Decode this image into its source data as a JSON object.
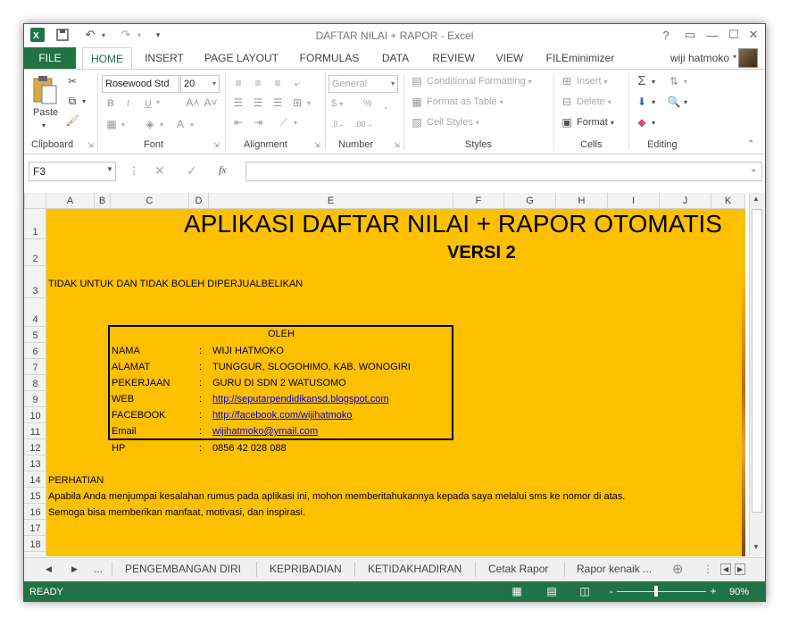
{
  "app": {
    "title": "DAFTAR NILAI + RAPOR - Excel",
    "user": "wiji hatmoko",
    "colors": {
      "excel_green": "#217346",
      "sheet_fill": "#ffc000",
      "link": "#0000ee"
    }
  },
  "quick_access": {
    "icons": [
      "excel-logo-icon",
      "save-icon",
      "undo-icon",
      "redo-icon",
      "customize-icon"
    ]
  },
  "window_controls": {
    "help": "?",
    "restore": "▭",
    "minimize": "—",
    "maximize": "☐",
    "close": "✕"
  },
  "ribbon_tabs": [
    "FILE",
    "HOME",
    "INSERT",
    "PAGE LAYOUT",
    "FORMULAS",
    "DATA",
    "REVIEW",
    "VIEW",
    "FILEminimizer"
  ],
  "ribbon": {
    "clipboard": {
      "label": "Clipboard",
      "paste": "Paste"
    },
    "font": {
      "label": "Font",
      "font_name": "Rosewood Std",
      "font_size": "20",
      "bold": "B",
      "italic": "I",
      "underline": "U"
    },
    "alignment": {
      "label": "Alignment"
    },
    "number": {
      "label": "Number",
      "format": "General",
      "currency": "$",
      "percent": "%",
      "comma": ","
    },
    "styles": {
      "label": "Styles",
      "conditional": "Conditional Formatting",
      "format_table": "Format as Table",
      "cell_styles": "Cell Styles"
    },
    "cells": {
      "label": "Cells",
      "insert": "Insert",
      "delete": "Delete",
      "format": "Format"
    },
    "editing": {
      "label": "Editing"
    }
  },
  "formula_bar": {
    "name_box": "F3",
    "fx": "fx",
    "content": ""
  },
  "columns": [
    "A",
    "B",
    "C",
    "D",
    "E",
    "F",
    "G",
    "H",
    "I",
    "J",
    "K"
  ],
  "rows": [
    "1",
    "2",
    "3",
    "4",
    "5",
    "6",
    "7",
    "8",
    "9",
    "10",
    "11",
    "12",
    "13",
    "14",
    "15",
    "16",
    "17",
    "18"
  ],
  "sheet": {
    "title": "APLIKASI DAFTAR NILAI + RAPOR OTOMATIS",
    "version": "VERSI 2",
    "notice": "TIDAK UNTUK DAN TIDAK BOLEH DIPERJUALBELIKAN",
    "by": "OLEH",
    "info": [
      {
        "label": "NAMA",
        "sep": ":",
        "value": "WIJI HATMOKO"
      },
      {
        "label": "ALAMAT",
        "sep": ":",
        "value": "TUNGGUR, SLOGOHIMO, KAB. WONOGIRI"
      },
      {
        "label": "PEKERJAAN",
        "sep": ":",
        "value": "GURU DI SDN 2 WATUSOMO"
      },
      {
        "label": "WEB",
        "sep": ":",
        "value": "http://seputarpendidikansd.blogspot.com"
      },
      {
        "label": "FACEBOOK",
        "sep": ":",
        "value": "http://facebook.com/wijihatmoko"
      },
      {
        "label": "Email",
        "sep": ":",
        "value": "wijihatmoko@ymail.com"
      },
      {
        "label": "HP",
        "sep": ":",
        "value": "0856 42 028 088"
      }
    ],
    "attention": "PERHATIAN",
    "message1": "Apabila Anda menjumpai kesalahan rumus pada aplikasi ini, mohon memberitahukannya kepada saya melalui sms ke nomor di atas.",
    "message2": "Semoga bisa memberikan manfaat, motivasi, dan inspirasi."
  },
  "sheet_tabs": {
    "more": "...",
    "tabs": [
      "PENGEMBANGAN DIRI",
      "KEPRIBADIAN",
      "KETIDAKHADIRAN",
      "Cetak Rapor",
      "Rapor kenaik ..."
    ]
  },
  "status": {
    "text": "READY",
    "zoom": "90%",
    "zoom_minus": "-",
    "zoom_plus": "+"
  }
}
